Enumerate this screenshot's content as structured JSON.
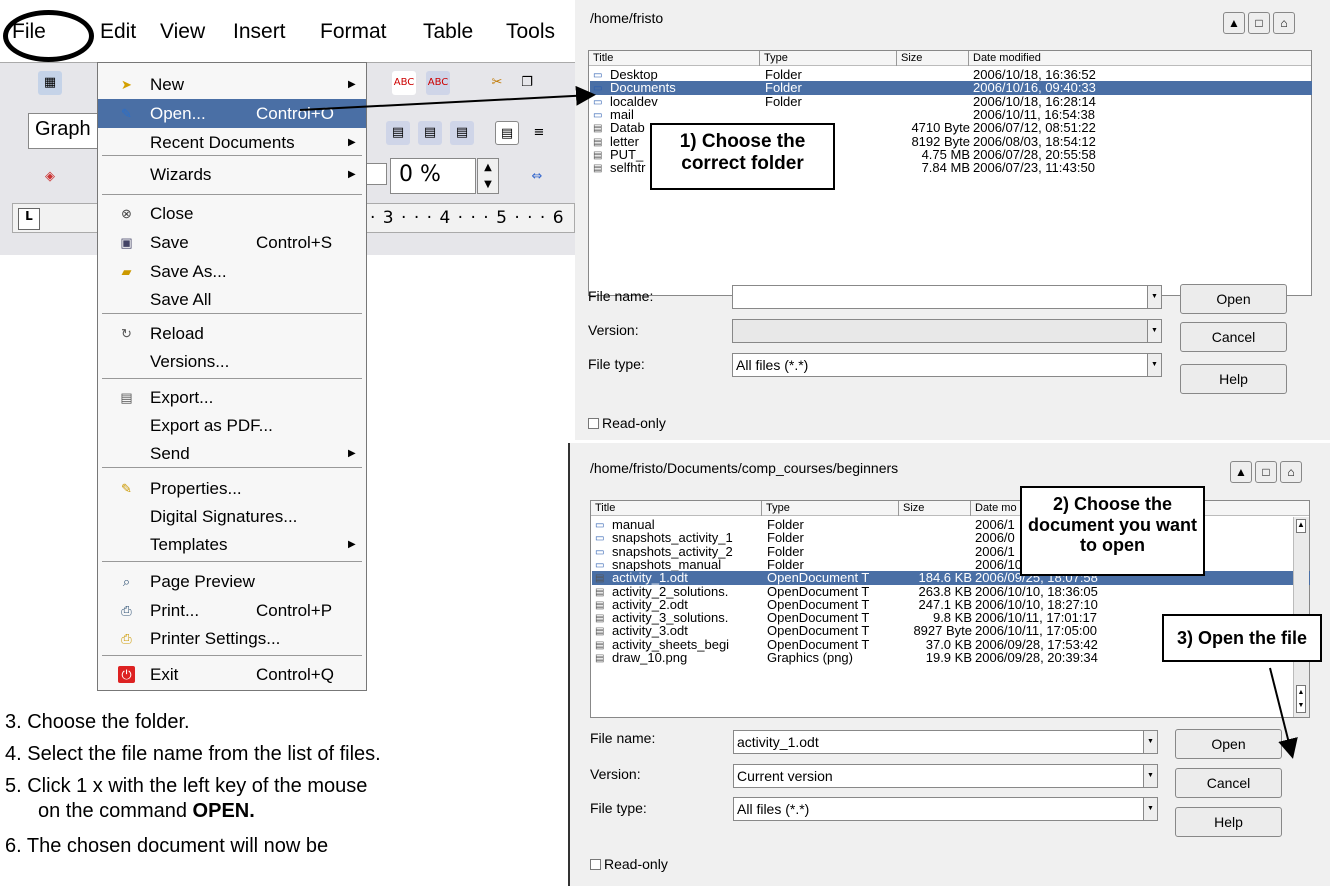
{
  "menubar": {
    "items": [
      "File",
      "Edit",
      "View",
      "Insert",
      "Format",
      "Table",
      "Tools"
    ]
  },
  "toolbar": {
    "style_box": "Graph",
    "zoom_value": "0 %",
    "ruler_numbers": "· 3 · · · 4 · · · 5 · · · 6"
  },
  "file_menu": {
    "items": [
      {
        "label": "New",
        "shortcut": "",
        "submenu": true,
        "icon": "new-icon"
      },
      {
        "label": "Open...",
        "shortcut": "Control+O",
        "submenu": false,
        "icon": "open-icon"
      },
      {
        "label": "Recent Documents",
        "shortcut": "",
        "submenu": true,
        "icon": ""
      },
      {
        "label": "Wizards",
        "shortcut": "",
        "submenu": true,
        "icon": ""
      },
      {
        "label": "Close",
        "shortcut": "",
        "submenu": false,
        "icon": "close-icon"
      },
      {
        "label": "Save",
        "shortcut": "Control+S",
        "submenu": false,
        "icon": "save-icon"
      },
      {
        "label": "Save As...",
        "shortcut": "",
        "submenu": false,
        "icon": "save-as-icon"
      },
      {
        "label": "Save All",
        "shortcut": "",
        "submenu": false,
        "icon": ""
      },
      {
        "label": "Reload",
        "shortcut": "",
        "submenu": false,
        "icon": "reload-icon"
      },
      {
        "label": "Versions...",
        "shortcut": "",
        "submenu": false,
        "icon": ""
      },
      {
        "label": "Export...",
        "shortcut": "",
        "submenu": false,
        "icon": "export-icon"
      },
      {
        "label": "Export as PDF...",
        "shortcut": "",
        "submenu": false,
        "icon": ""
      },
      {
        "label": "Send",
        "shortcut": "",
        "submenu": true,
        "icon": ""
      },
      {
        "label": "Properties...",
        "shortcut": "",
        "submenu": false,
        "icon": "properties-icon"
      },
      {
        "label": "Digital Signatures...",
        "shortcut": "",
        "submenu": false,
        "icon": ""
      },
      {
        "label": "Templates",
        "shortcut": "",
        "submenu": true,
        "icon": ""
      },
      {
        "label": "Page Preview",
        "shortcut": "",
        "submenu": false,
        "icon": "page-preview-icon"
      },
      {
        "label": "Print...",
        "shortcut": "Control+P",
        "submenu": false,
        "icon": "print-icon"
      },
      {
        "label": "Printer Settings...",
        "shortcut": "",
        "submenu": false,
        "icon": "printer-settings-icon"
      },
      {
        "label": "Exit",
        "shortcut": "Control+Q",
        "submenu": false,
        "icon": "exit-icon"
      }
    ]
  },
  "dialog1": {
    "path": "/home/fristo",
    "columns": [
      "Title",
      "Type",
      "Size",
      "Date modified"
    ],
    "rows": [
      {
        "title": "Desktop",
        "type": "Folder",
        "size": "",
        "date": "2006/10/18, 16:36:52"
      },
      {
        "title": "Documents",
        "type": "Folder",
        "size": "",
        "date": "2006/10/16, 09:40:33"
      },
      {
        "title": "localdev",
        "type": "Folder",
        "size": "",
        "date": "2006/10/18, 16:28:14"
      },
      {
        "title": "mail",
        "type": "",
        "size": "",
        "date": "2006/10/11, 16:54:38"
      },
      {
        "title": "Datab",
        "type": "ment D",
        "size": "4710 Byte",
        "date": "2006/07/12, 08:51:22"
      },
      {
        "title": "letter",
        "type": "docume",
        "size": "8192 Byte",
        "date": "2006/08/03, 18:54:12"
      },
      {
        "title": "PUT_",
        "type": "e (zip)",
        "size": "4.75 MB",
        "date": "2006/07/28, 20:55:58"
      },
      {
        "title": "selfhtr",
        "type": "e (zip)",
        "size": "7.84 MB",
        "date": "2006/07/23, 11:43:50"
      }
    ],
    "file_name_label": "File name:",
    "file_name_value": "",
    "version_label": "Version:",
    "version_value": "",
    "file_type_label": "File type:",
    "file_type_value": "All files (*.*)",
    "open": "Open",
    "cancel": "Cancel",
    "help": "Help",
    "readonly": "Read-only"
  },
  "dialog2": {
    "path": "/home/fristo/Documents/comp_courses/beginners",
    "columns": [
      "Title",
      "Type",
      "Size",
      "Date mo"
    ],
    "rows": [
      {
        "title": "manual",
        "type": "Folder",
        "size": "",
        "date": "2006/1"
      },
      {
        "title": "snapshots_activity_1",
        "type": "Folder",
        "size": "",
        "date": "2006/0"
      },
      {
        "title": "snapshots_activity_2",
        "type": "Folder",
        "size": "",
        "date": "2006/1"
      },
      {
        "title": "snapshots_manual",
        "type": "Folder",
        "size": "",
        "date": "2006/10/18, 19:05:12"
      },
      {
        "title": "activity_1.odt",
        "type": "OpenDocument T",
        "size": "184.6 KB",
        "date": "2006/09/25, 18:07:58"
      },
      {
        "title": "activity_2_solutions.",
        "type": "OpenDocument T",
        "size": "263.8 KB",
        "date": "2006/10/10, 18:36:05"
      },
      {
        "title": "activity_2.odt",
        "type": "OpenDocument T",
        "size": "247.1 KB",
        "date": "2006/10/10, 18:27:10"
      },
      {
        "title": "activity_3_solutions.",
        "type": "OpenDocument T",
        "size": "9.8 KB",
        "date": "2006/10/11, 17:01:17"
      },
      {
        "title": "activity_3.odt",
        "type": "OpenDocument T",
        "size": "8927 Byte",
        "date": "2006/10/11, 17:05:00"
      },
      {
        "title": "activity_sheets_begi",
        "type": "OpenDocument T",
        "size": "37.0 KB",
        "date": "2006/09/28, 17:53:42"
      },
      {
        "title": "draw_10.png",
        "type": "Graphics (png)",
        "size": "19.9 KB",
        "date": "2006/09/28, 20:39:34"
      }
    ],
    "file_name_label": "File name:",
    "file_name_value": "activity_1.odt",
    "version_label": "Version:",
    "version_value": "Current version",
    "file_type_label": "File type:",
    "file_type_value": "All files (*.*)",
    "open": "Open",
    "cancel": "Cancel",
    "help": "Help",
    "readonly": "Read-only"
  },
  "callouts": {
    "c1": "1) Choose the correct folder",
    "c2": "2) Choose the document you want to open",
    "c3": "3) Open the file"
  },
  "instructions": [
    "3. Choose the folder.",
    "4. Select the file name from the list of files.",
    "5. Click 1 x with the left key of the mouse",
    "on the command",
    "OPEN.",
    "6. The chosen document will now be"
  ]
}
